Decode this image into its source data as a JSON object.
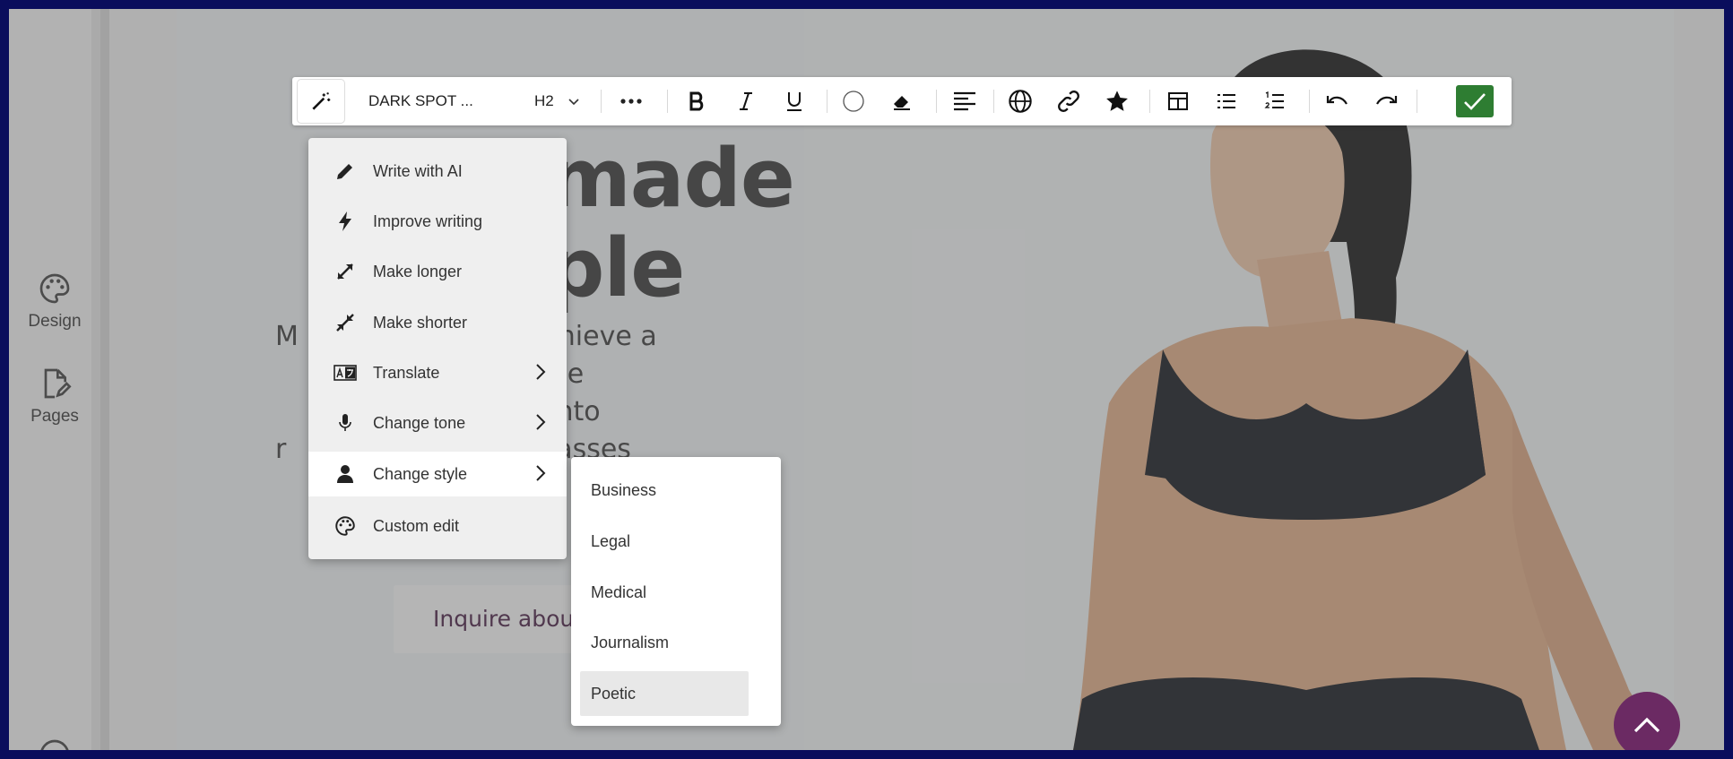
{
  "sidebar": {
    "items": [
      {
        "label": "Design",
        "icon": "palette-icon"
      },
      {
        "label": "Pages",
        "icon": "page-edit-icon"
      }
    ]
  },
  "canvas": {
    "hero_title_lines": [
      "made",
      "ple"
    ],
    "hero_text_lines": [
      "M          ssion is to achieve a",
      "         alance within the",
      "         corporate this into",
      "r          ring unique classes"
    ],
    "cta_label": "Inquire abou"
  },
  "toolbar": {
    "font_name": "DARK SPOT ...",
    "heading_level": "H2",
    "icons": [
      "ai-magic-icon",
      "more-icon",
      "bold-icon",
      "italic-icon",
      "underline-icon",
      "color-circle-icon",
      "eraser-icon",
      "align-icon",
      "globe-icon",
      "link-icon",
      "star-icon",
      "table-icon",
      "bullet-list-icon",
      "numbered-list-icon",
      "undo-icon",
      "redo-icon",
      "check-icon"
    ],
    "accent_color": "#2e7d32"
  },
  "ai_menu": {
    "items": [
      {
        "label": "Write with AI",
        "icon": "pencil-icon",
        "submenu": false
      },
      {
        "label": "Improve writing",
        "icon": "lightning-icon",
        "submenu": false
      },
      {
        "label": "Make longer",
        "icon": "expand-icon",
        "submenu": false
      },
      {
        "label": "Make shorter",
        "icon": "collapse-icon",
        "submenu": false
      },
      {
        "label": "Translate",
        "icon": "translate-icon",
        "submenu": true
      },
      {
        "label": "Change tone",
        "icon": "microphone-icon",
        "submenu": true
      },
      {
        "label": "Change style",
        "icon": "person-icon",
        "submenu": true
      },
      {
        "label": "Custom edit",
        "icon": "palette-icon",
        "submenu": false
      }
    ]
  },
  "style_menu": {
    "items": [
      "Business",
      "Legal",
      "Medical",
      "Journalism",
      "Poetic"
    ],
    "highlighted": "Poetic"
  },
  "fab_color": "#6b2a63"
}
